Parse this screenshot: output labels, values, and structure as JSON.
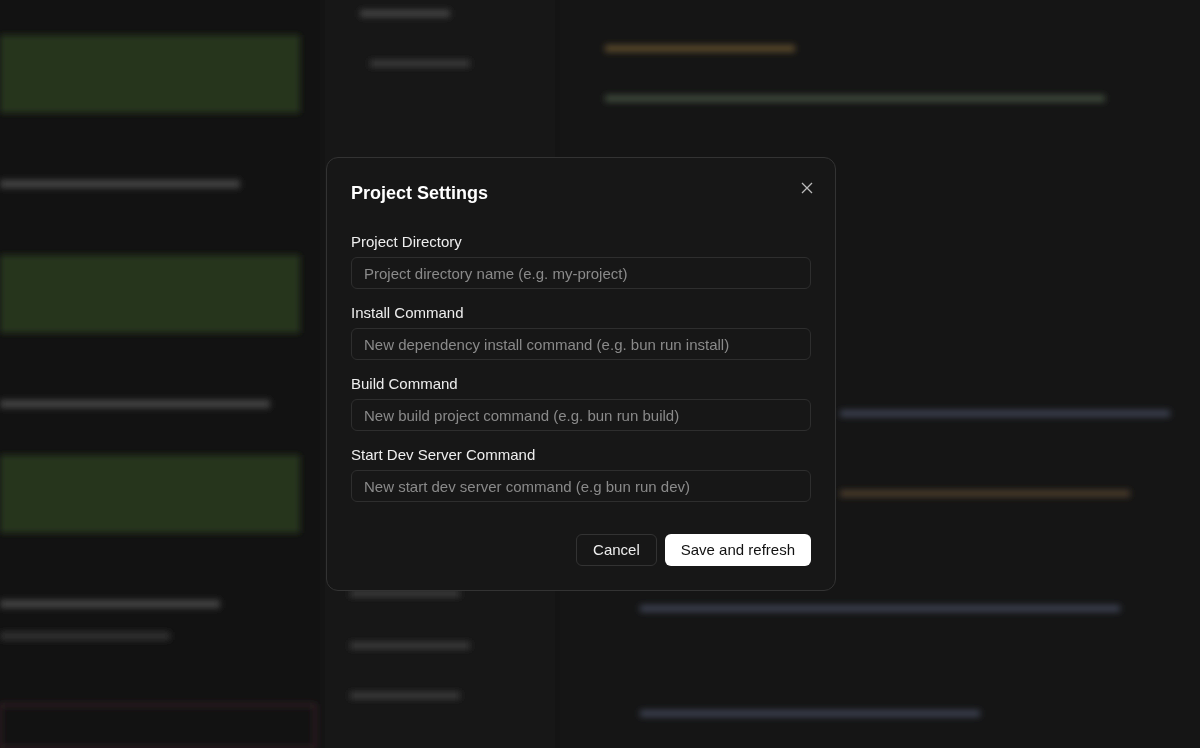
{
  "dialog": {
    "title": "Project Settings",
    "fields": [
      {
        "label": "Project Directory",
        "placeholder": "Project directory name (e.g. my-project)"
      },
      {
        "label": "Install Command",
        "placeholder": "New dependency install command (e.g. bun run install)"
      },
      {
        "label": "Build Command",
        "placeholder": "New build project command (e.g. bun run build)"
      },
      {
        "label": "Start Dev Server Command",
        "placeholder": "New start dev server command (e.g bun run dev)"
      }
    ],
    "buttons": [
      {
        "label": "Cancel",
        "kind": "secondary"
      },
      {
        "label": "Save and refresh",
        "kind": "primary"
      }
    ]
  }
}
